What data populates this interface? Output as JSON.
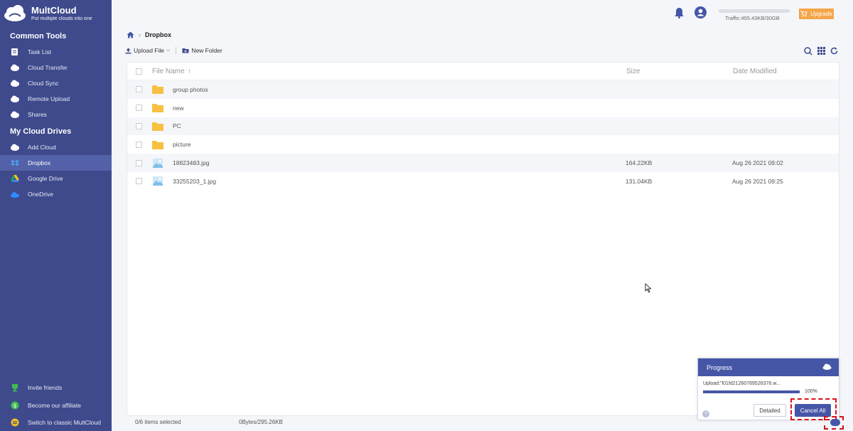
{
  "brand": {
    "name": "MultCloud",
    "tagline": "Put multiple clouds into one"
  },
  "sidebar": {
    "common_tools_title": "Common Tools",
    "common_tools": [
      {
        "label": "Task List",
        "icon": "task-list-icon"
      },
      {
        "label": "Cloud Transfer",
        "icon": "cloud-transfer-icon"
      },
      {
        "label": "Cloud Sync",
        "icon": "cloud-sync-icon"
      },
      {
        "label": "Remote Upload",
        "icon": "remote-upload-icon"
      },
      {
        "label": "Shares",
        "icon": "shares-icon"
      }
    ],
    "my_drives_title": "My Cloud Drives",
    "drives": [
      {
        "label": "Add Cloud",
        "icon": "add-cloud-icon"
      },
      {
        "label": "Dropbox",
        "icon": "dropbox-icon",
        "active": true
      },
      {
        "label": "Google Drive",
        "icon": "google-drive-icon"
      },
      {
        "label": "OneDrive",
        "icon": "onedrive-icon"
      }
    ],
    "bottom": [
      {
        "label": "Invite friends",
        "icon": "trophy-icon"
      },
      {
        "label": "Become our affiliate",
        "icon": "dollar-icon"
      },
      {
        "label": "Switch to classic MultCloud",
        "icon": "switch-icon"
      }
    ]
  },
  "header": {
    "traffic": "Traffic:455.43KB/30GB",
    "upgrade_label": "Upgrade"
  },
  "breadcrumb": {
    "current": "Dropbox"
  },
  "toolbar": {
    "upload_label": "Upload File",
    "new_folder_label": "New Folder"
  },
  "table": {
    "columns": {
      "name": "File Name",
      "size": "Size",
      "date": "Date Modified"
    },
    "rows": [
      {
        "name": "group photos",
        "type": "folder",
        "size": "",
        "date": ""
      },
      {
        "name": "new",
        "type": "folder",
        "size": "",
        "date": ""
      },
      {
        "name": "PC",
        "type": "folder",
        "size": "",
        "date": ""
      },
      {
        "name": "picture",
        "type": "folder",
        "size": "",
        "date": ""
      },
      {
        "name": "18823483.jpg",
        "type": "image",
        "size": "164.22KB",
        "date": "Aug 26 2021 09:02"
      },
      {
        "name": "33255203_1.jpg",
        "type": "image",
        "size": "131.04KB",
        "date": "Aug 26 2021 09:25"
      }
    ]
  },
  "footer": {
    "selected": "0/6 items selected",
    "usage": "0Bytes/295.26KB"
  },
  "progress": {
    "title": "Progress",
    "task": "Upload:\"l01fd21260769526376.w...",
    "percent": "100%",
    "value": 1.0,
    "detailed_label": "Detailed",
    "cancel_label": "Cancel All",
    "help_label": "?"
  },
  "colors": {
    "sidebar": "#3e4a8c",
    "accent": "#4656a7",
    "upgrade": "#f5a54a",
    "folder": "#f7c042",
    "highlight": "#d8121a"
  }
}
